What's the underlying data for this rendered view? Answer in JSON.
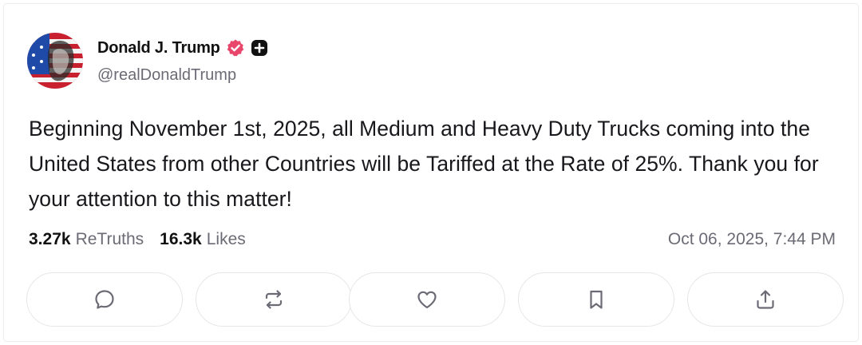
{
  "post": {
    "author": {
      "name": "Donald J. Trump",
      "handle": "@realDonaldTrump",
      "avatar_icon": "avatar-icon",
      "verified_icon": "verified-badge-icon",
      "verified_color": "#e8476b"
    },
    "text": "Beginning November 1st, 2025, all Medium and Heavy Duty Trucks coming into the United States from other Countries will be Tariffed at the Rate of 25%. Thank you for your attention to this matter!",
    "stats": {
      "retruths_count": "3.27k",
      "retruths_label": "ReTruths",
      "likes_count": "16.3k",
      "likes_label": "Likes"
    },
    "timestamp": "Oct 06, 2025, 7:44 PM"
  },
  "actions": [
    {
      "name": "reply",
      "icon": "comment-icon"
    },
    {
      "name": "retruth",
      "icon": "repost-icon"
    },
    {
      "name": "like",
      "icon": "heart-icon"
    },
    {
      "name": "bookmark",
      "icon": "bookmark-icon"
    },
    {
      "name": "share",
      "icon": "share-icon"
    }
  ]
}
